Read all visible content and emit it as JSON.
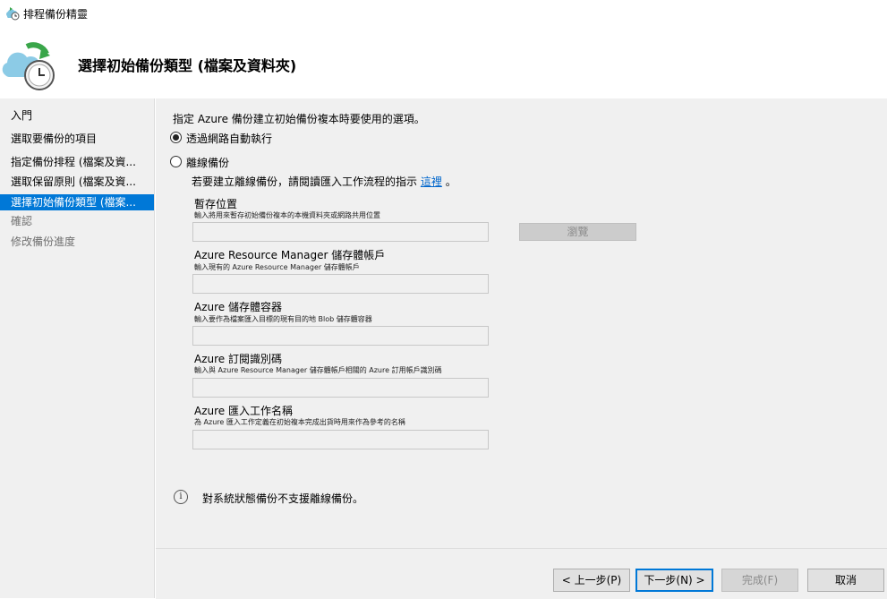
{
  "window": {
    "title": "排程備份精靈"
  },
  "header": {
    "title": "選擇初始備份類型 (檔案及資料夾)"
  },
  "sidebar": {
    "items": [
      {
        "label": "入門",
        "state": "normal"
      },
      {
        "label": "選取要備份的項目",
        "state": "normal"
      },
      {
        "label": "指定備份排程 (檔案及資...",
        "state": "normal"
      },
      {
        "label": "選取保留原則 (檔案及資...",
        "state": "normal"
      },
      {
        "label": "選擇初始備份類型 (檔案...",
        "state": "active"
      },
      {
        "label": "確認",
        "state": "disabled"
      },
      {
        "label": "修改備份進度",
        "state": "disabled"
      }
    ]
  },
  "main": {
    "instruction": "指定 Azure 備份建立初始備份複本時要使用的選項。",
    "options": [
      {
        "label": "透過網路自動執行",
        "checked": true
      },
      {
        "label": "離線備份",
        "checked": false
      }
    ],
    "offline_note": "若要建立離線備份，請閱讀匯入工作流程的指示",
    "offline_link": "這裡",
    "offline_note_suffix": "。",
    "fields": [
      {
        "label": "暫存位置",
        "desc": "輸入將用來暫存初始備份複本的本機資料夾或網路共用位置",
        "value": ""
      },
      {
        "label": "Azure Resource Manager 儲存體帳戶",
        "desc": "輸入現有的 Azure Resource Manager 儲存體帳戶",
        "value": ""
      },
      {
        "label": "Azure 儲存體容器",
        "desc": "輸入要作為檔案匯入目標的現有目的地 Blob 儲存體容器",
        "value": ""
      },
      {
        "label": "Azure 訂閱識別碼",
        "desc": "輸入與 Azure Resource Manager 儲存體帳戶相關的 Azure 訂用帳戶識別碼",
        "value": ""
      },
      {
        "label": "Azure 匯入工作名稱",
        "desc": "為 Azure 匯入工作定義在初始複本完成出貨時用來作為參考的名稱",
        "value": ""
      }
    ],
    "browse_label": "瀏覽",
    "info_text": "對系統狀態備份不支援離線備份。"
  },
  "footer": {
    "prev": "< 上一步(P)",
    "next": "下一步(N) >",
    "finish": "完成(F)",
    "cancel": "取消"
  },
  "colors": {
    "accent": "#0078d7",
    "panel": "#f0f0f0",
    "link": "#0066cc"
  }
}
